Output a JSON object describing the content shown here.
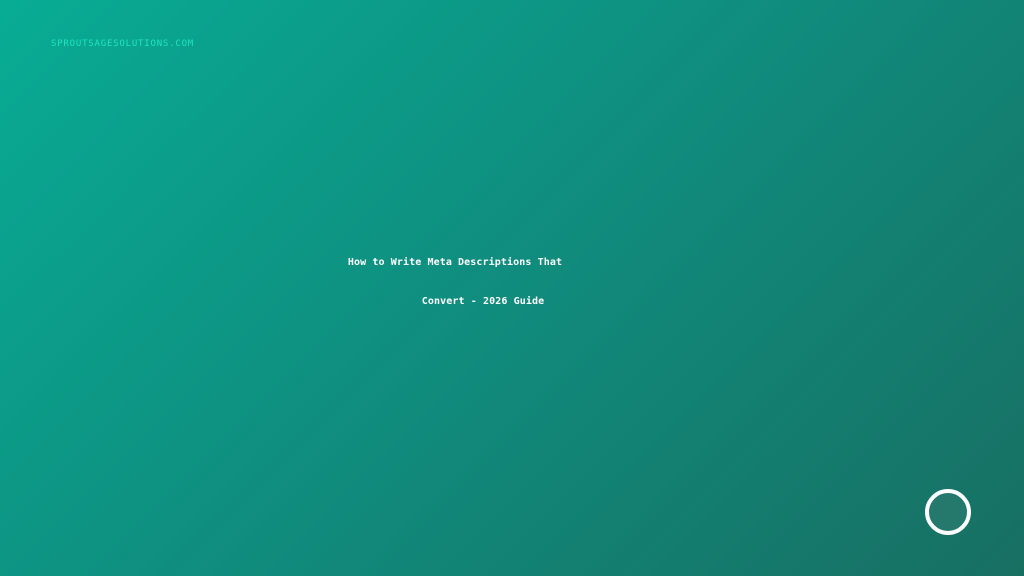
{
  "header": {
    "site_label": "SPROUTSAGESOLUTIONS.COM"
  },
  "main": {
    "headline_lines": [
      "How to Write Meta Descriptions That",
      "Convert - 2026 Guide"
    ]
  },
  "logo": {
    "icon": "ring-logo-icon"
  },
  "colors": {
    "gradient_start": "#08ac94",
    "gradient_end": "#176f62",
    "accent": "#1fe6bf",
    "text": "#ffffff"
  }
}
